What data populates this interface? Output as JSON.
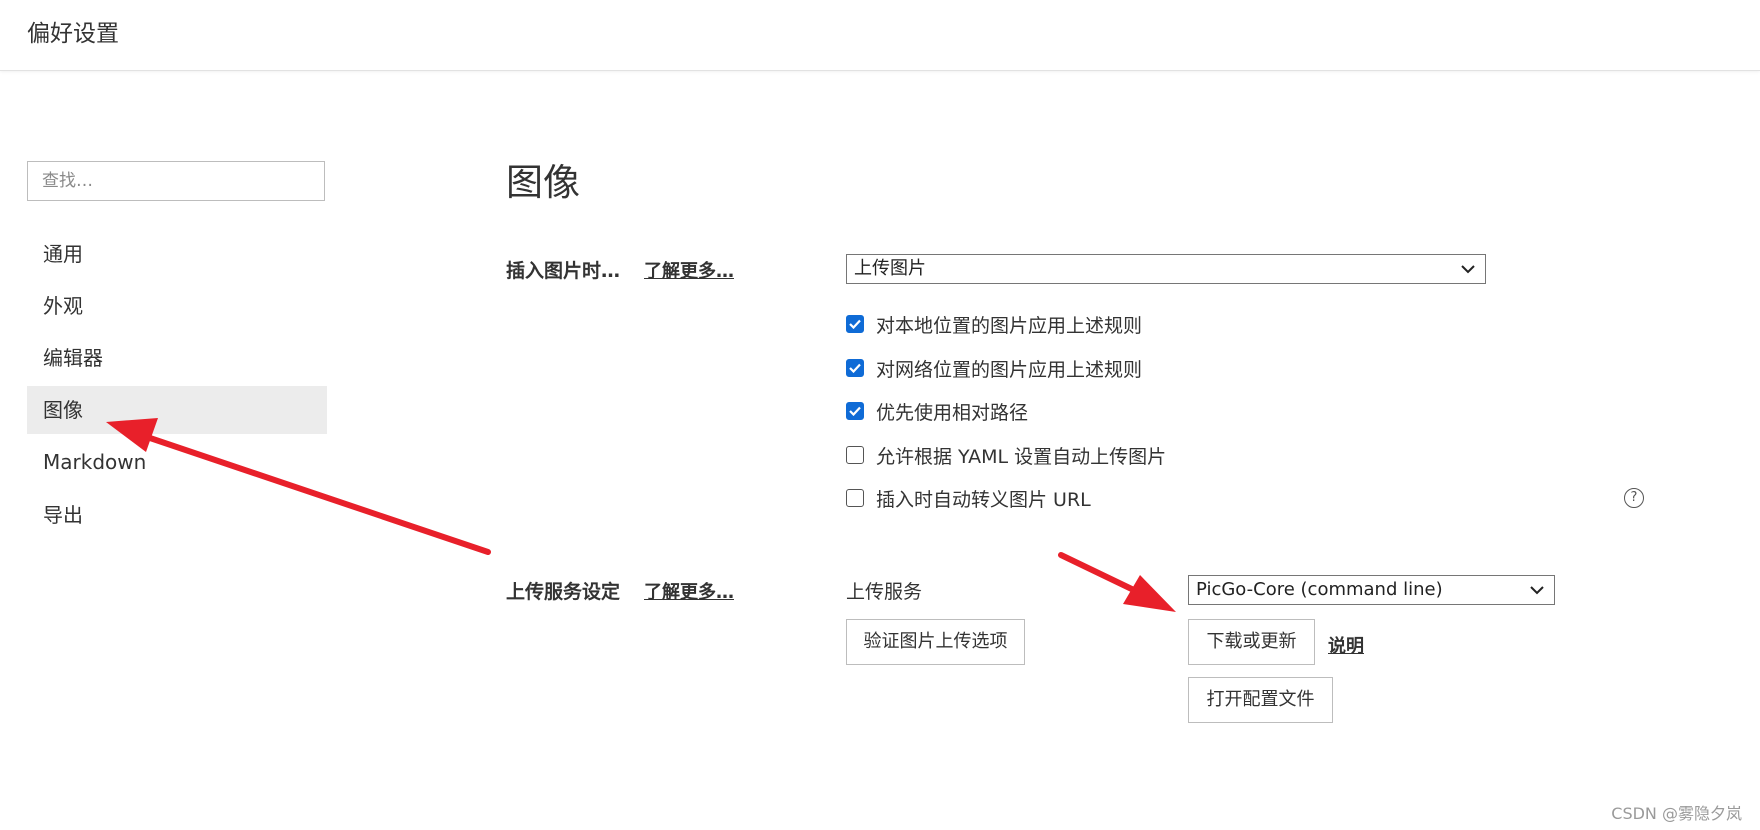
{
  "window": {
    "title": "偏好设置"
  },
  "sidebar": {
    "search_placeholder": "查找…",
    "items": [
      {
        "label": "通用"
      },
      {
        "label": "外观"
      },
      {
        "label": "编辑器"
      },
      {
        "label": "图像",
        "active": true
      },
      {
        "label": "Markdown"
      },
      {
        "label": "导出"
      }
    ]
  },
  "main": {
    "title": "图像",
    "insert": {
      "label": "插入图片时…",
      "learn_more": "了解更多…",
      "select_value": "上传图片",
      "options": [
        {
          "label": "对本地位置的图片应用上述规则",
          "checked": true
        },
        {
          "label": "对网络位置的图片应用上述规则",
          "checked": true
        },
        {
          "label": "优先使用相对路径",
          "checked": true
        },
        {
          "label": "允许根据 YAML 设置自动上传图片",
          "checked": false
        },
        {
          "label": "插入时自动转义图片 URL",
          "checked": false
        }
      ],
      "help_icon": "question-circle-icon",
      "help_glyph": "?"
    },
    "upload": {
      "label": "上传服务设定",
      "learn_more": "了解更多…",
      "service_label": "上传服务",
      "service_value": "PicGo-Core (command line)",
      "verify_button": "验证图片上传选项",
      "download_button": "下载或更新",
      "explain_link": "说明",
      "open_config_button": "打开配置文件"
    }
  },
  "annotations": {
    "arrow_color": "#e8202a"
  },
  "colors": {
    "checkbox_accent": "#0f6bd6",
    "active_nav_bg": "#ececec"
  },
  "watermark": "CSDN @雾隐夕岚"
}
